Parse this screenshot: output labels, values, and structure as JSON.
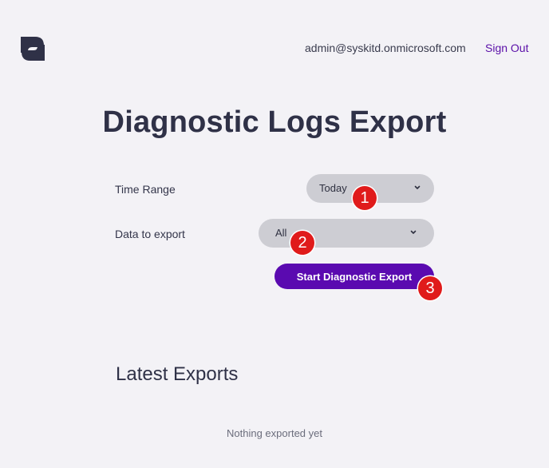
{
  "header": {
    "logo_icon": "syskit-logo-icon",
    "user_email": "admin@syskitd.onmicrosoft.com",
    "sign_out_label": "Sign Out"
  },
  "page": {
    "title": "Diagnostic Logs Export"
  },
  "form": {
    "time_range": {
      "label": "Time Range",
      "selected": "Today",
      "icon": "chevron-down-icon"
    },
    "data_to_export": {
      "label": "Data to export",
      "selected": "All",
      "icon": "chevron-down-icon"
    },
    "start_button_label": "Start Diagnostic Export"
  },
  "annotations": {
    "markers": [
      "1",
      "2",
      "3"
    ],
    "color": "#e01b1b"
  },
  "latest_exports": {
    "title": "Latest Exports",
    "empty_message": "Nothing exported yet"
  },
  "colors": {
    "background": "#f3f2f6",
    "accent": "#5a0ab0",
    "select_bg": "#cdcdd3",
    "text": "#2e3040"
  }
}
